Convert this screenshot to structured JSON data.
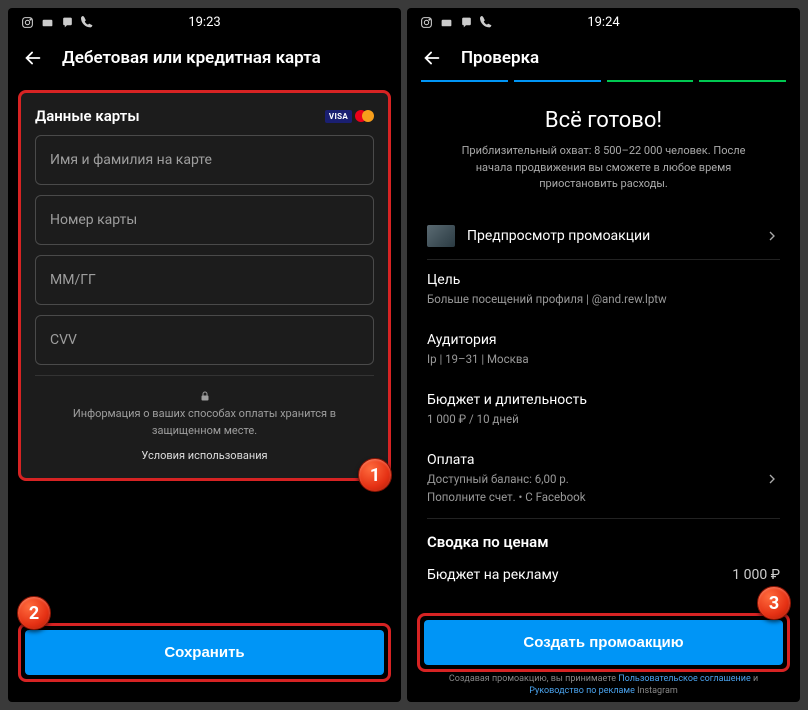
{
  "left": {
    "status_time": "19:23",
    "title": "Дебетовая или кредитная карта",
    "card_section_title": "Данные карты",
    "fields": {
      "name": "Имя и фамилия на карте",
      "number": "Номер карты",
      "expiry": "ММ/ГГ",
      "cvv": "CVV"
    },
    "security_note": "Информация о ваших способах оплаты хранится в защищенном месте.",
    "terms": "Условия использования",
    "save_button": "Сохранить"
  },
  "right": {
    "status_time": "19:24",
    "title": "Проверка",
    "heading": "Всё готово!",
    "subheading": "Приблизительный охват: 8 500–22 000 человек. После начала продвижения вы сможете в любое время приостановить расходы.",
    "preview_label": "Предпросмотр промоакции",
    "goal": {
      "title": "Цель",
      "value": "Больше посещений профиля | @and.rew.lptw"
    },
    "audience": {
      "title": "Аудитория",
      "value": "Ip | 19–31 | Москва"
    },
    "budget": {
      "title": "Бюджет и длительность",
      "value": "1 000 ₽ / 10 дней"
    },
    "payment": {
      "title": "Оплата",
      "line1": "Доступный баланс: 6,00 р.",
      "line2": "Пополните счет. • С Facebook"
    },
    "summary_title": "Сводка по ценам",
    "ad_budget_label": "Бюджет на рекламу",
    "ad_budget_value": "1 000 ₽",
    "create_button": "Создать промоакцию",
    "disclaimer_pre": "Создавая промоакцию, вы принимаете ",
    "disclaimer_link1": "Пользовательское соглашение",
    "disclaimer_mid": " и ",
    "disclaimer_link2": "Руководство по рекламе",
    "disclaimer_post": " Instagram"
  },
  "badges": {
    "one": "1",
    "two": "2",
    "three": "3"
  }
}
